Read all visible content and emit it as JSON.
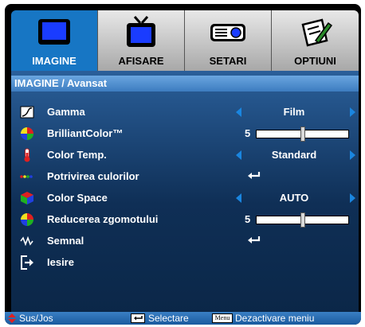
{
  "tabs": [
    {
      "label": "IMAGINE",
      "icon": "monitor-icon",
      "active": true
    },
    {
      "label": "AFISARE",
      "icon": "tv-icon",
      "active": false
    },
    {
      "label": "SETARI",
      "icon": "projector-icon",
      "active": false
    },
    {
      "label": "OPTIUNI",
      "icon": "options-pen-icon",
      "active": false
    }
  ],
  "panel": {
    "title": "IMAGINE / Avansat",
    "rows": [
      {
        "label": "Gamma",
        "icon": "gamma-icon",
        "value": "Film"
      },
      {
        "label": "BrilliantColor™",
        "icon": "brilliantcolor-icon",
        "number": "5",
        "slider_level": 0.5
      },
      {
        "label": "Color Temp.",
        "icon": "thermometer-icon",
        "value": "Standard"
      },
      {
        "label": "Potrivirea culorilor",
        "icon": "color-match-icon"
      },
      {
        "label": "Color Space",
        "icon": "color-space-cube-icon",
        "value": "AUTO"
      },
      {
        "label": "Reducerea zgomotului",
        "icon": "noise-reduction-icon",
        "number": "5",
        "slider_level": 0.5
      },
      {
        "label": "Semnal",
        "icon": "signal-icon"
      },
      {
        "label": "Iesire",
        "icon": "exit-icon"
      }
    ]
  },
  "status": {
    "nav_label": "Sus/Jos",
    "select_label": "Selectare",
    "menu_key": "Menu",
    "menu_label": "Dezactivare meniu"
  },
  "colors": {
    "accent": "#1776c4",
    "arrow": "#1a86e0",
    "panel_top": "#2a5f9a",
    "panel_bottom": "#0b2748"
  }
}
